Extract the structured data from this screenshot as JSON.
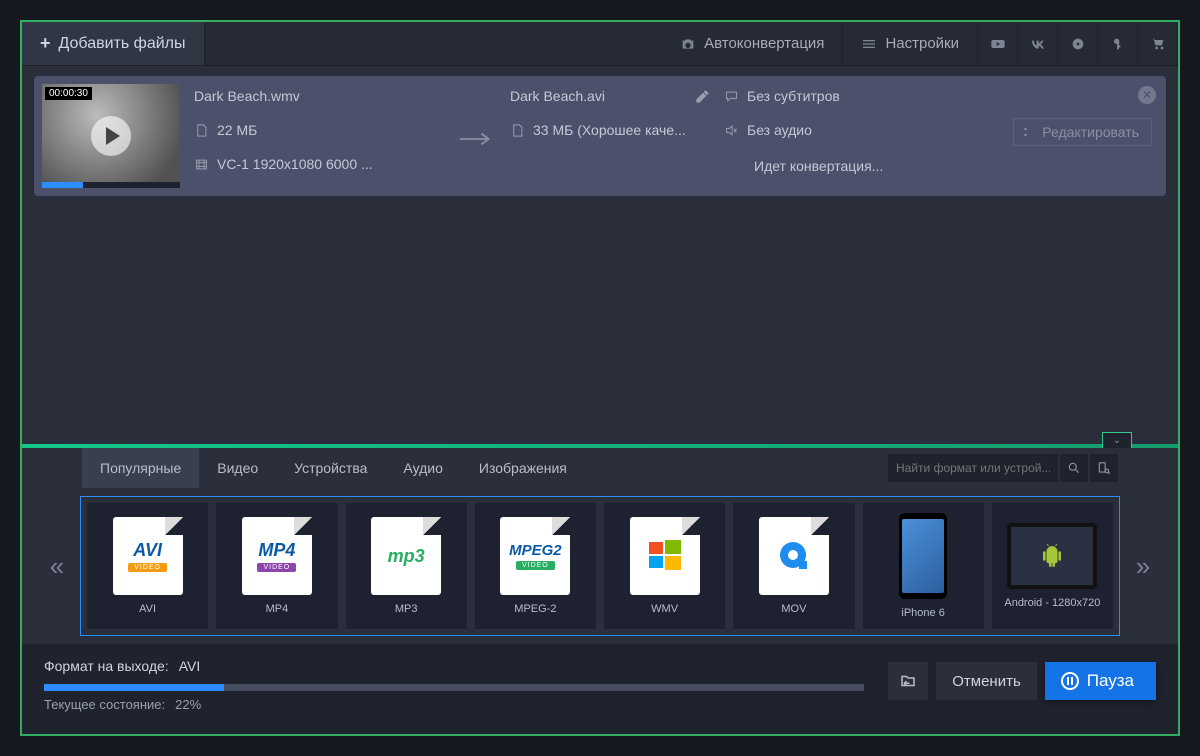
{
  "toolbar": {
    "add_files": "Добавить файлы",
    "auto_convert": "Автоконвертация",
    "settings": "Настройки"
  },
  "item": {
    "thumb_duration": "00:00:30",
    "src_name": "Dark Beach.wmv",
    "src_size": "22 МБ",
    "src_stream": "VC-1 1920x1080 6000 ...",
    "dst_name": "Dark Beach.avi",
    "dst_size": "33 МБ (Хорошее каче...",
    "subtitles": "Без субтитров",
    "audio": "Без аудио",
    "status": "Идет конвертация...",
    "edit_btn": "Редактировать"
  },
  "tabs": {
    "popular": "Популярные",
    "video": "Видео",
    "devices": "Устройства",
    "audio": "Аудио",
    "images": "Изображения",
    "search_placeholder": "Найти формат или устрой..."
  },
  "formats": {
    "avi": "AVI",
    "mp4": "MP4",
    "mp3": "MP3",
    "mpeg2": "MPEG-2",
    "wmv": "WMV",
    "mov": "MOV",
    "iphone": "iPhone 6",
    "android": "Android - 1280x720"
  },
  "bottom": {
    "out_label": "Формат на выходе:",
    "out_value": "AVI",
    "state_label": "Текущее состояние:",
    "state_value": "22%",
    "progress_pct": 22,
    "cancel": "Отменить",
    "pause": "Пауза"
  }
}
